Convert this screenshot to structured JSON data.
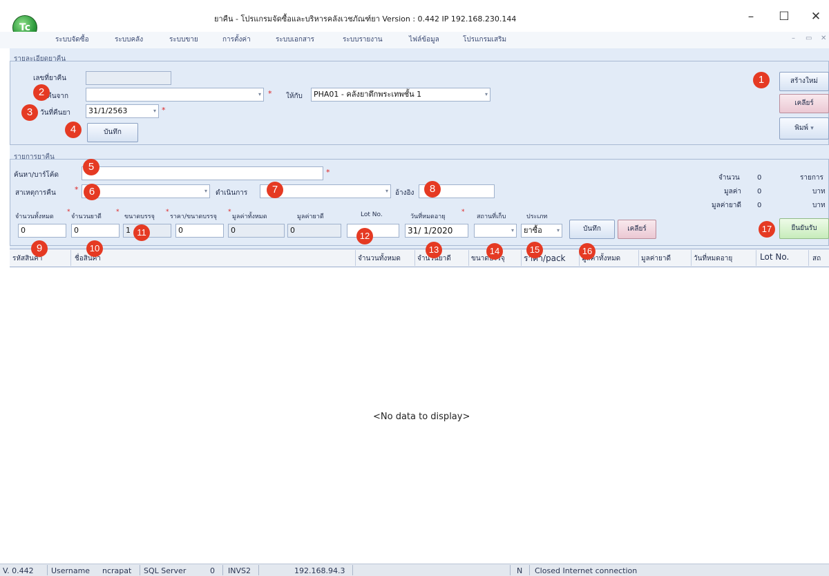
{
  "window": {
    "logo_text": "Tc",
    "title": "ยาคืน - โปรแกรมจัดซื้อและบริหารคลังเวชภัณฑ์ยา Version : 0.442  IP 192.168.230.144",
    "minimize": "–",
    "maximize": "☐",
    "close": "✕"
  },
  "menu": [
    "ระบบจัดซื้อ",
    "ระบบคลัง",
    "ระบบขาย",
    "การตั้งค่า",
    "ระบบเอกสาร",
    "ระบบรายงาน",
    "ไฟล์ข้อมูล",
    "โปรแกรมเสริม"
  ],
  "mdi_controls": [
    "–",
    "▭",
    "✕"
  ],
  "header_section": {
    "legend": "รายละเอียดยาคืน",
    "doc_no_label": "เลขที่ยาคืน",
    "doc_no_value": "",
    "return_from_label": "คืนจาก",
    "return_from_value": "",
    "return_to_label": "ให้กับ",
    "return_to_value": "PHA01 - คลังยาตึกพระเทพชั้น 1",
    "return_date_label": "วันที่คืนยา",
    "return_date_value": "31/1/2563",
    "save_button": "บันทึก",
    "new_button": "สร้างใหม่",
    "clear_button": "เคลียร์",
    "print_button": "พิมพ์",
    "dropdown_arrow": "▾",
    "required_mark": "*"
  },
  "items_section": {
    "legend": "รายการยาคืน",
    "search_label": "ค้นหา/บาร์โค้ด",
    "search_value": "",
    "reason_label": "สาเหตุการคืน",
    "reason_value": "",
    "action_label": "ดำเนินการ",
    "action_value": "",
    "ref_label": "อ้างอิง",
    "ref_value": "",
    "fields": {
      "total_qty_label": "จำนวนทั้งหมด",
      "total_qty_value": "0",
      "drug_qty_label": "จำนวนยาดี",
      "drug_qty_value": "0",
      "pack_size_label": "ขนาดบรรจุ",
      "pack_size_value": "1",
      "price_label": "ราคา/ขนาดบรรจุ",
      "price_value": "0",
      "total_value_label": "มูลค่าทั้งหมด",
      "total_value_value": "0",
      "good_value_label": "มูลค่ายาดี",
      "good_value_value": "0",
      "lot_label": "Lot No.",
      "lot_value": "",
      "expiry_label": "วันที่หมดอายุ",
      "expiry_value": "31/ 1/2020",
      "location_label": "สถานที่เก็บ",
      "location_value": "",
      "type_label": "ประเภท",
      "type_value": "ยาซื้อ",
      "save_button": "บันทึก",
      "clear_button": "เคลียร์"
    },
    "summary": {
      "count_label": "จำนวน",
      "count_value": "0",
      "count_unit": "รายการ",
      "value_label": "มูลค่า",
      "value_value": "0",
      "value_unit": "บาท",
      "good_label": "มูลค่ายาดี",
      "good_value": "0",
      "good_unit": "บาท"
    },
    "confirm_button": "ยืนยันรับ"
  },
  "grid": {
    "columns": [
      "รหัสสินค้า",
      "ชื่อสินค้า",
      "จำนวนทั้งหมด",
      "จำนวนยาดี",
      "ขนาดบรรจุ",
      "ราคา/pack",
      "มูลค่าทั้งหมด",
      "มูลค่ายาดี",
      "วันที่หมดอายุ",
      "Lot No.",
      "สถ"
    ],
    "empty_text": "<No data to display>"
  },
  "badges": [
    "1",
    "2",
    "3",
    "4",
    "5",
    "6",
    "7",
    "8",
    "9",
    "10",
    "11",
    "12",
    "13",
    "14",
    "15",
    "16",
    "17"
  ],
  "status_bar": {
    "version": "V. 0.442",
    "username_label": "Username",
    "username": "ncrapat",
    "db_label": "SQL Server",
    "db_index": "0",
    "db_name": "INVS2",
    "server_ip": "192.168.94.3",
    "mode": "N",
    "connection": "Closed Internet connection"
  }
}
